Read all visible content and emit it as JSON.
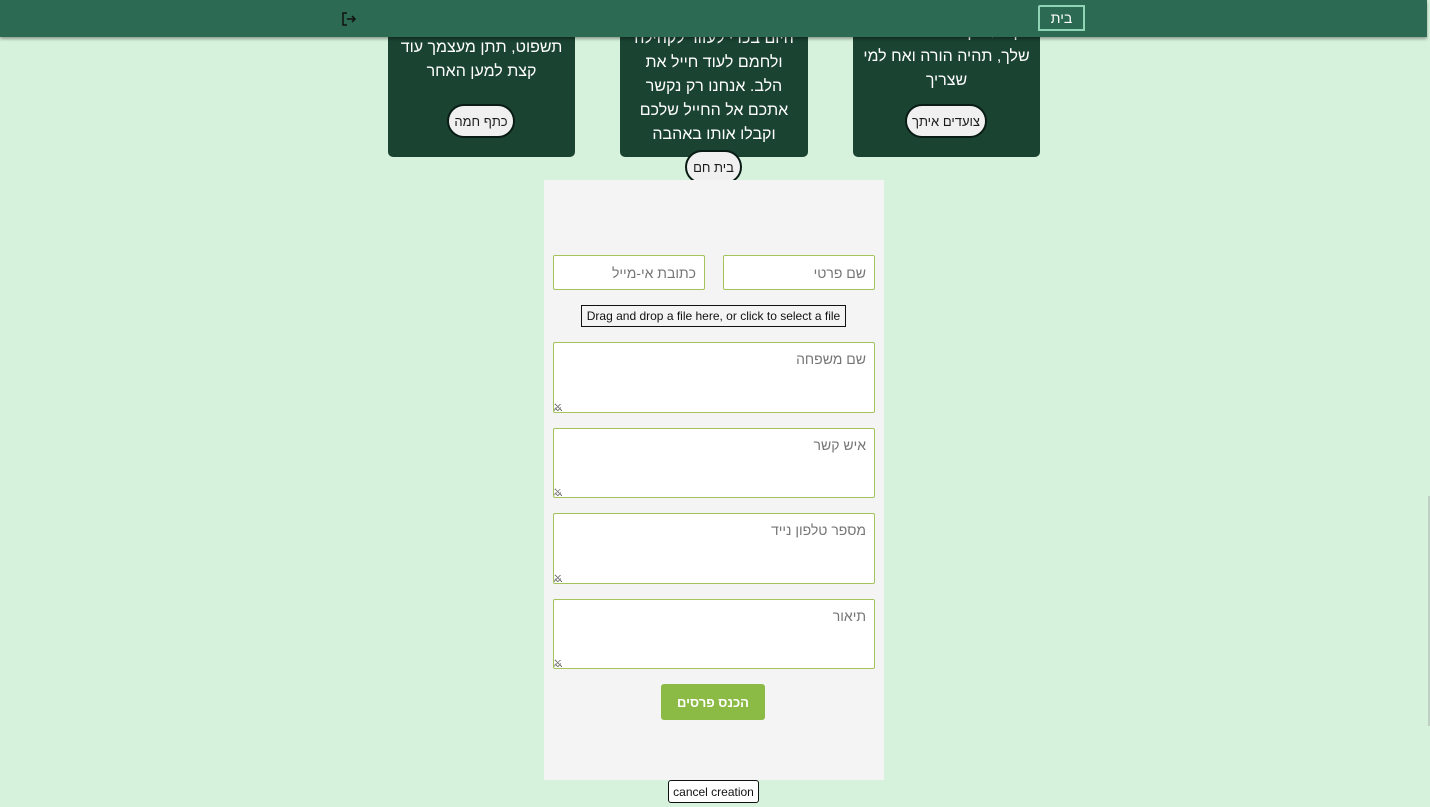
{
  "header": {
    "home_label": "בית",
    "logout_icon": "logout-icon"
  },
  "cards": [
    {
      "text": "תשפוט, תתן מעצמך עוד קצת למען האחר",
      "button": "כתף חמה"
    },
    {
      "text": "היום בכדי לעזור לקהילה ולחמם לעוד חייל את הלב. אנחנו רק נקשר אתכם אל החייל שלכם וקבלו אותו באהבה",
      "button": "בית חם"
    },
    {
      "text": "הן הלב קצת בבית החיים שלך, תהיה הורה ואח למי שצריך",
      "button": "צועדים איתך"
    }
  ],
  "form": {
    "first_name_placeholder": "שם פרטי",
    "email_placeholder": "כתובת אי-מייל",
    "file_drop_label": "Drag and drop a file here, or click to select a file",
    "last_name_placeholder": "שם משפחה",
    "contact_placeholder": "איש קשר",
    "phone_placeholder": "מספר טלפון נייד",
    "description_placeholder": "תיאור",
    "submit_label": "הכנס פרסים",
    "cancel_label": "cancel creation"
  },
  "colors": {
    "background": "#d7f2dc",
    "header": "#2d6a53",
    "card": "#1b4332",
    "accent": "#8cbb45"
  }
}
